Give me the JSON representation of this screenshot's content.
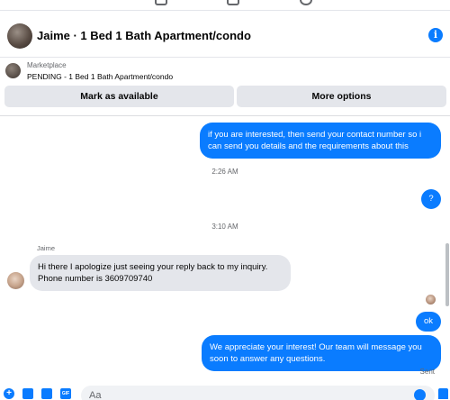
{
  "header": {
    "title": "Jaime · 1 Bed 1 Bath Apartment/condo",
    "info_icon": "i"
  },
  "marketplace": {
    "label": "Marketplace",
    "status": "PENDING - 1 Bed 1 Bath Apartment/condo",
    "button_available": "Mark as available",
    "button_more": "More options"
  },
  "messages": {
    "out1": "if you are interested, then send your contact number so i can send you details and the requirements about this",
    "ts1": "2:26 AM",
    "out2": "?",
    "ts2": "3:10 AM",
    "sender": "Jaime",
    "in1": "Hi there I apologize just seeing your reply back to my inquiry. Phone number is 3609709740",
    "out3": "ok",
    "out4": "We appreciate your interest! Our team will message you soon to answer any questions.",
    "sent_status": "Sent"
  },
  "composer": {
    "placeholder": "Aa",
    "plus_icon": "+",
    "gif_label": "GIF"
  },
  "colors": {
    "accent": "#0a7cff",
    "incoming_bubble": "#e4e6eb",
    "muted_text": "#65676b"
  }
}
